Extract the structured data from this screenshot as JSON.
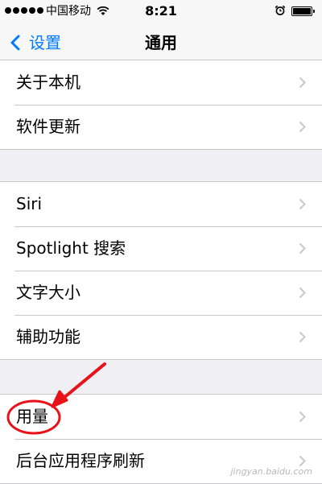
{
  "status_bar": {
    "carrier": "中国移动",
    "time": "8:21",
    "signal_icon": "signal-dots-icon",
    "wifi_icon": "wifi-icon",
    "alarm_icon": "alarm-clock-icon",
    "battery_icon": "battery-icon"
  },
  "nav": {
    "back_label": "设置",
    "title": "通用",
    "accent_color": "#007aff"
  },
  "groups": [
    {
      "items": [
        {
          "label": "关于本机"
        },
        {
          "label": "软件更新"
        }
      ]
    },
    {
      "items": [
        {
          "label": "Siri"
        },
        {
          "label": "Spotlight 搜索"
        },
        {
          "label": "文字大小"
        },
        {
          "label": "辅助功能"
        }
      ]
    },
    {
      "items": [
        {
          "label": "用量"
        },
        {
          "label": "后台应用程序刷新"
        }
      ]
    }
  ],
  "annotation": {
    "color": "#e8121a"
  },
  "watermark": {
    "text": "jingyan.baidu.com"
  }
}
